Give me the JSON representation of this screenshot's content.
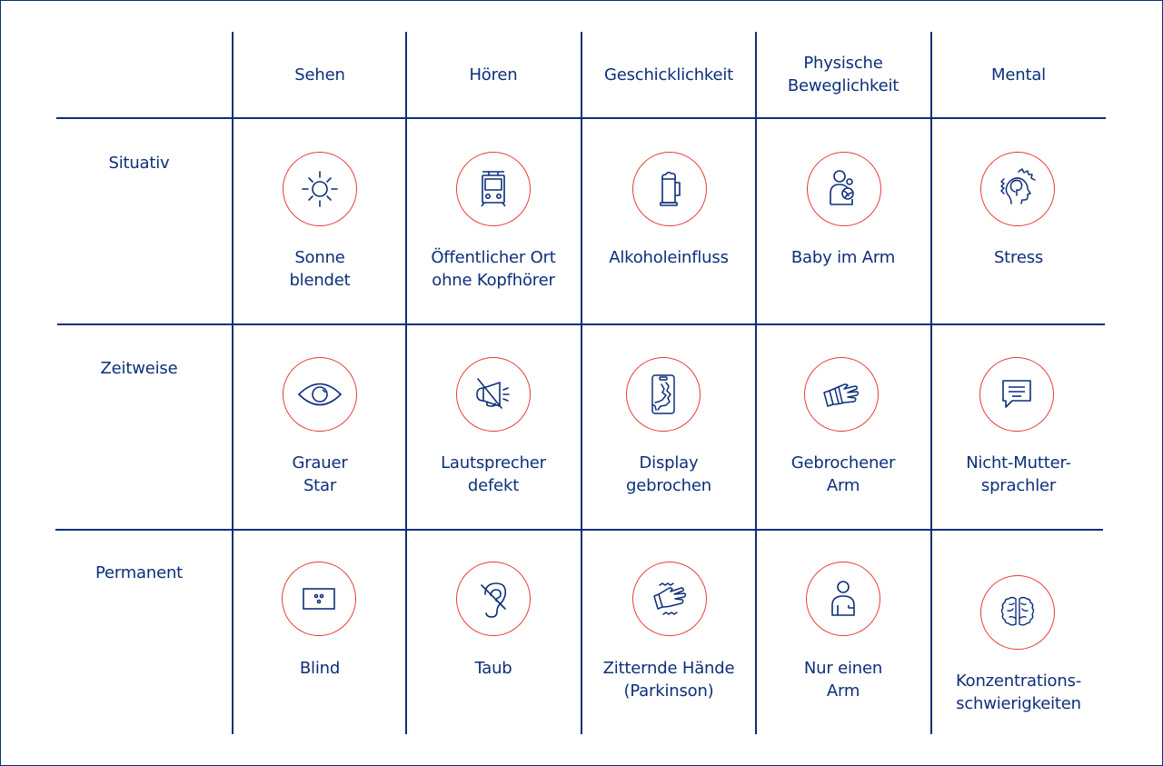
{
  "colors": {
    "ink": "#0d2f7a",
    "accent": "#ea3b3b",
    "background": "#ffffff"
  },
  "columns": [
    {
      "label": "Sehen"
    },
    {
      "label": "Hören"
    },
    {
      "label": "Geschicklichkeit"
    },
    {
      "label": "Physische\nBeweglichkeit"
    },
    {
      "label": "Mental"
    }
  ],
  "rows": [
    {
      "label": "Situativ",
      "cells": [
        {
          "icon": "sun-icon",
          "label": "Sonne\nblendet"
        },
        {
          "icon": "tram-icon",
          "label": "Öffentlicher Ort\nohne Kopfhörer"
        },
        {
          "icon": "beer-mug-icon",
          "label": "Alkoholeinfluss"
        },
        {
          "icon": "person-holding-baby-icon",
          "label": "Baby im Arm"
        },
        {
          "icon": "stressed-head-icon",
          "label": "Stress"
        }
      ]
    },
    {
      "label": "Zeitweise",
      "cells": [
        {
          "icon": "eye-icon",
          "label": "Grauer\nStar"
        },
        {
          "icon": "muted-megaphone-icon",
          "label": "Lautsprecher\ndefekt"
        },
        {
          "icon": "cracked-phone-icon",
          "label": "Display\ngebrochen"
        },
        {
          "icon": "bandaged-hand-icon",
          "label": "Gebrochener\nArm"
        },
        {
          "icon": "speech-bubble-icon",
          "label": "Nicht-Mutter-\nsprachler"
        }
      ]
    },
    {
      "label": "Permanent",
      "cells": [
        {
          "icon": "braille-icon",
          "label": "Blind"
        },
        {
          "icon": "deaf-ear-icon",
          "label": "Taub"
        },
        {
          "icon": "shaking-hand-icon",
          "label": "Zitternde Hände\n(Parkinson)"
        },
        {
          "icon": "one-arm-person-icon",
          "label": "Nur einen\nArm"
        },
        {
          "icon": "brain-icon",
          "label": "Konzentrations-\nschwierigkeiten"
        }
      ]
    }
  ]
}
